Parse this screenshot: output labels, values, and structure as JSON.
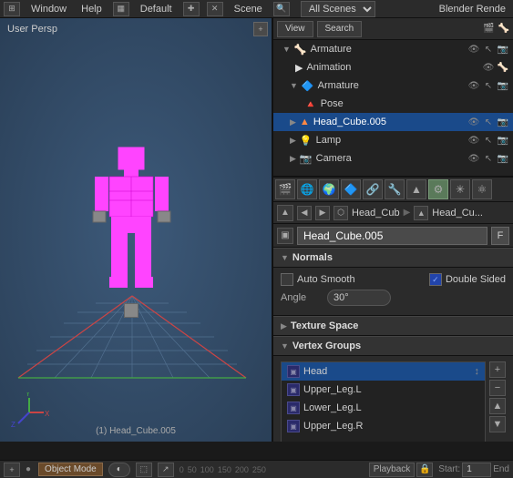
{
  "topbar": {
    "menus": [
      "Window",
      "Help"
    ],
    "default_label": "Default",
    "scene_label": "Scene",
    "all_scenes_label": "All Scenes",
    "blender_render_label": "Blender Rende"
  },
  "viewport": {
    "label": "User Persp",
    "frame_info": "(1) Head_Cube.005"
  },
  "outliner": {
    "view_btn": "View",
    "search_btn": "Search",
    "items": [
      {
        "name": "Armature",
        "indent": 0,
        "type": "armature",
        "has_children": true
      },
      {
        "name": "Animation",
        "indent": 1,
        "type": "action",
        "has_children": false
      },
      {
        "name": "Armature",
        "indent": 1,
        "type": "mesh",
        "has_children": false
      },
      {
        "name": "Pose",
        "indent": 2,
        "type": "pose",
        "has_children": false
      },
      {
        "name": "Head_Cube.005",
        "indent": 1,
        "type": "mesh",
        "has_children": false,
        "selected": true
      },
      {
        "name": "Lamp",
        "indent": 1,
        "type": "lamp",
        "has_children": false
      },
      {
        "name": "Camera",
        "indent": 1,
        "type": "camera",
        "has_children": false
      }
    ]
  },
  "props": {
    "breadcrumb1": "Head_Cub",
    "breadcrumb2": "Head_Cu...",
    "obj_name": "Head_Cube.005",
    "f_btn": "F",
    "normals_section": "Normals",
    "texture_space_section": "Texture Space",
    "vertex_groups_section": "Vertex Groups",
    "auto_smooth_label": "Auto Smooth",
    "double_sided_label": "Double Sided",
    "angle_label": "Angle",
    "angle_value": "30°",
    "vertex_groups": [
      {
        "name": "Head",
        "selected": true
      },
      {
        "name": "Upper_Leg.L",
        "selected": false
      },
      {
        "name": "Lower_Leg.L",
        "selected": false
      },
      {
        "name": "Upper_Leg.R",
        "selected": false
      }
    ]
  },
  "bottom": {
    "playback_label": "Playback",
    "start_label": "Start:",
    "start_value": "1",
    "end_label": "End"
  }
}
